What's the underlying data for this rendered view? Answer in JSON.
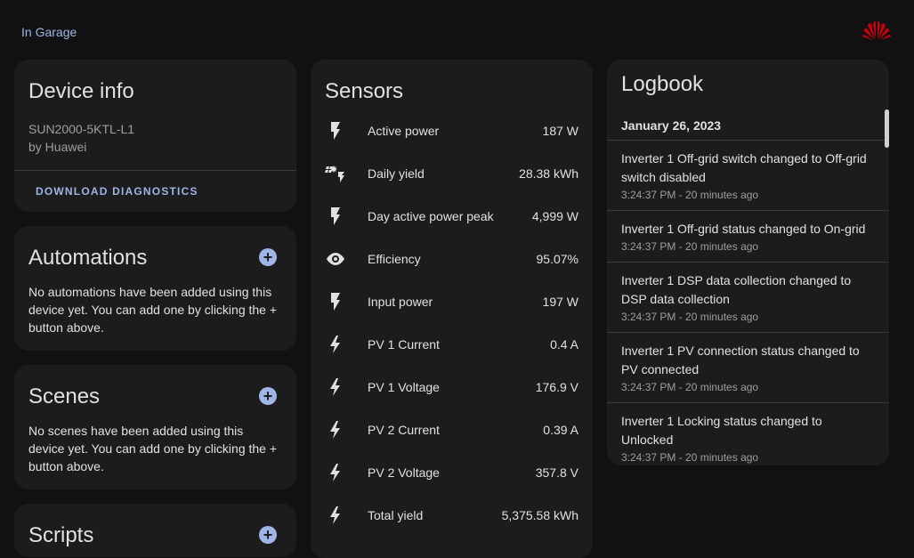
{
  "breadcrumb": "In Garage",
  "device_info": {
    "title": "Device info",
    "model": "SUN2000-5KTL-L1",
    "manufacturer": "by Huawei",
    "download_label": "Download diagnostics"
  },
  "automations": {
    "title": "Automations",
    "description": "No automations have been added using this device yet. You can add one by clicking the + button above."
  },
  "scenes": {
    "title": "Scenes",
    "description": "No scenes have been added using this device yet. You can add one by clicking the + button above."
  },
  "scripts": {
    "title": "Scripts"
  },
  "sensors": {
    "title": "Sensors",
    "items": [
      {
        "name": "Active power",
        "value": "187 W",
        "icon": "flash-icon"
      },
      {
        "name": "Daily yield",
        "value": "28.38 kWh",
        "icon": "solar-power-icon"
      },
      {
        "name": "Day active power peak",
        "value": "4,999 W",
        "icon": "flash-icon"
      },
      {
        "name": "Efficiency",
        "value": "95.07%",
        "icon": "eye-icon"
      },
      {
        "name": "Input power",
        "value": "197 W",
        "icon": "flash-icon"
      },
      {
        "name": "PV 1 Current",
        "value": "0.4 A",
        "icon": "lightning-bolt-icon"
      },
      {
        "name": "PV 1 Voltage",
        "value": "176.9 V",
        "icon": "lightning-bolt-icon"
      },
      {
        "name": "PV 2 Current",
        "value": "0.39 A",
        "icon": "lightning-bolt-icon"
      },
      {
        "name": "PV 2 Voltage",
        "value": "357.8 V",
        "icon": "lightning-bolt-icon"
      },
      {
        "name": "Total yield",
        "value": "5,375.58 kWh",
        "icon": "lightning-bolt-icon"
      }
    ]
  },
  "logbook": {
    "title": "Logbook",
    "date": "January 26, 2023",
    "entries": [
      {
        "text": "Inverter 1 Off-grid switch changed to Off-grid switch disabled",
        "time": "3:24:37 PM - 20 minutes ago"
      },
      {
        "text": "Inverter 1 Off-grid status changed to On-grid",
        "time": "3:24:37 PM - 20 minutes ago"
      },
      {
        "text": "Inverter 1 DSP data collection changed to DSP data collection",
        "time": "3:24:37 PM - 20 minutes ago"
      },
      {
        "text": "Inverter 1 PV connection status changed to PV connected",
        "time": "3:24:37 PM - 20 minutes ago"
      },
      {
        "text": "Inverter 1 Locking status changed to Unlocked",
        "time": "3:24:37 PM - 20 minutes ago"
      }
    ]
  },
  "colors": {
    "background": "#111111",
    "card": "#1c1c1c",
    "accent": "#9fb5e6",
    "brand": "#c7000b"
  }
}
